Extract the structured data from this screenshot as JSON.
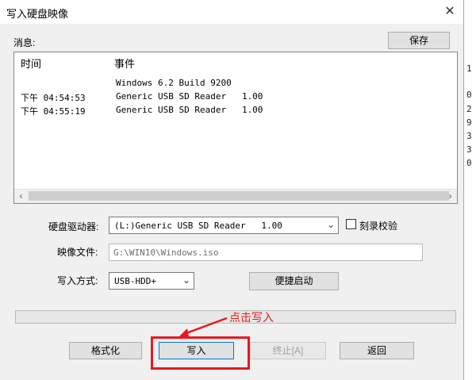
{
  "window": {
    "title": "写入硬盘映像",
    "close_glyph": "✕"
  },
  "messages": {
    "label": "消息:",
    "save_label": "保存",
    "columns": [
      "时间",
      "事件"
    ],
    "rows": [
      {
        "time": "",
        "event": "Windows 6.2 Build 9200"
      },
      {
        "time": "下午 04:54:53",
        "event": "Generic USB SD Reader   1.00"
      },
      {
        "time": "下午 04:55:19",
        "event": "Generic USB SD Reader   1.00"
      }
    ]
  },
  "drive": {
    "label": "硬盘驱动器:",
    "value": "(L:)Generic USB SD Reader   1.00",
    "verify_label": "刻录校验",
    "verify_checked": false
  },
  "image_file": {
    "label": "映像文件:",
    "value": "G:\\WIN10\\Windows.iso"
  },
  "write_method": {
    "label": "写入方式:",
    "value": "USB-HDD+",
    "quick_boot_label": "便捷启动"
  },
  "progress": {
    "value": 0
  },
  "buttons": {
    "format": "格式化",
    "write": "写入",
    "stop": "终止[A]",
    "back": "返回"
  },
  "annotation": {
    "text": "点击写入",
    "color": "#e8191f"
  },
  "right_strip_digits": [
    "1",
    "0",
    "2",
    "9",
    "3",
    "3",
    "0"
  ]
}
